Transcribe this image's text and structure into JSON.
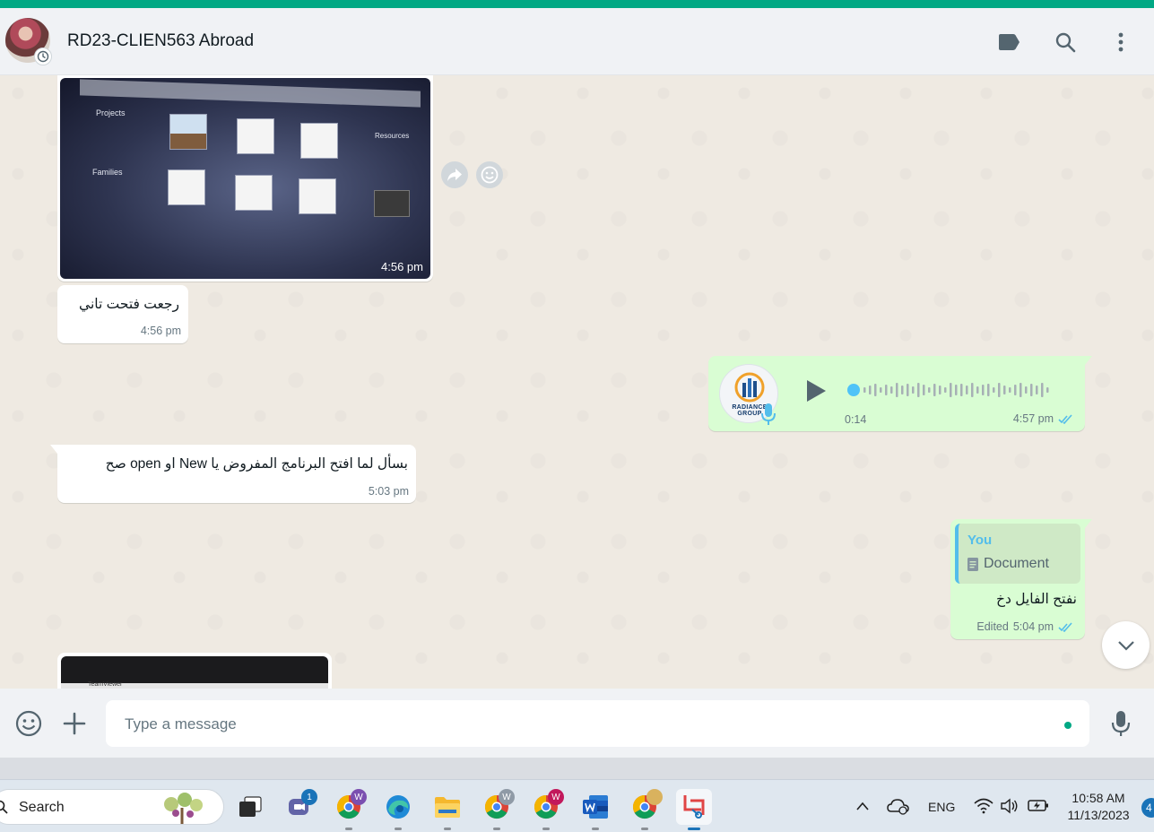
{
  "header": {
    "chat_title": "RD23-CLIEN563 Abroad",
    "icons": [
      "labels-icon",
      "search-icon",
      "menu-icon"
    ]
  },
  "messages": {
    "image1": {
      "time": "4:56 pm",
      "screen": {
        "projects_label": "Projects",
        "families_label": "Families",
        "resources_label": "Resources"
      }
    },
    "text1": {
      "text": "رجعت فتحت تاني",
      "time": "4:56 pm"
    },
    "voice": {
      "duration": "0:14",
      "time": "4:57 pm",
      "avatar_label": "RADIANCE GROUP"
    },
    "text2": {
      "text": "بسأل لما افتح البرنامج المفروض يا New او open صح",
      "time": "5:03 pm"
    },
    "reply": {
      "quote_author": "You",
      "quote_type": "Document",
      "text": "نفتح الفايل دخ",
      "edited_label": "Edited",
      "time": "5:04 pm"
    },
    "image2": {
      "screen_label": "TeamViewer"
    }
  },
  "composer": {
    "placeholder": "Type a message"
  },
  "taskbar": {
    "search_label": "Search",
    "teams_badge": "1",
    "chrome_badge_1": "W",
    "chrome_badge_2": "W",
    "chrome_badge_3": "W",
    "tray": {
      "language": "ENG",
      "time": "10:58 AM",
      "date": "11/13/2023",
      "notification_count": "4"
    }
  },
  "colors": {
    "accent": "#00a884",
    "outgoing_bubble": "#d9fdd3",
    "incoming_bubble": "#ffffff",
    "read_ticks": "#53bdeb",
    "chat_background": "#efeae2"
  }
}
